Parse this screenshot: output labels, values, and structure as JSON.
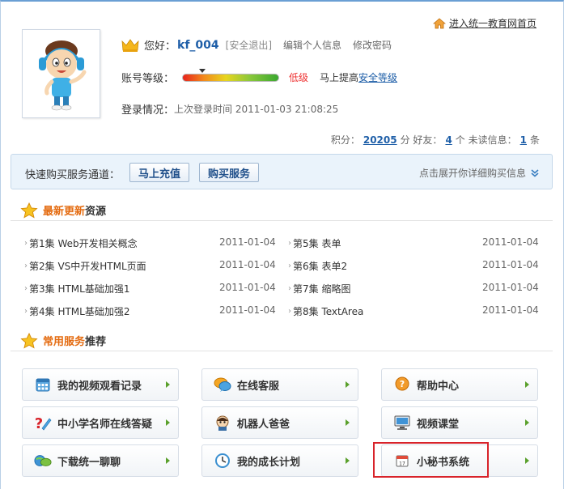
{
  "header": {
    "home_link": "进入统一教育网首页",
    "greeting": "您好：",
    "username": "kf_004",
    "logout": "[安全退出]",
    "edit_profile": "编辑个人信息",
    "change_password": "修改密码",
    "level_label": "账号等级：",
    "security_level": "低级",
    "improve_prefix": "马上提高",
    "improve_link": "安全等级",
    "security_level_fraction": 0.2,
    "login_label": "登录情况：",
    "last_login": "上次登录时间 2011-01-03 21:08:25"
  },
  "stats": {
    "points_label": "积分：",
    "points": "20205",
    "points_unit": "分 好友：",
    "friends": "4",
    "friends_unit": "个 未读信息：",
    "unread": "1",
    "unread_unit": "条"
  },
  "buybar": {
    "label": "快速购买服务通道：",
    "recharge": "马上充值",
    "buy_service": "购买服务",
    "expand": "点击展开你详细购买信息"
  },
  "latest": {
    "title_highlight": "最新更新",
    "title_rest": "资源",
    "items": [
      {
        "title": "第1集 Web开发相关概念",
        "date": "2011-01-04"
      },
      {
        "title": "第2集 VS中开发HTML页面",
        "date": "2011-01-04"
      },
      {
        "title": "第3集 HTML基础加强1",
        "date": "2011-01-04"
      },
      {
        "title": "第4集 HTML基础加强2",
        "date": "2011-01-04"
      },
      {
        "title": "第5集 表单",
        "date": "2011-01-04"
      },
      {
        "title": "第6集 表单2",
        "date": "2011-01-04"
      },
      {
        "title": "第7集 缩略图",
        "date": "2011-01-04"
      },
      {
        "title": "第8集 TextArea",
        "date": "2011-01-04"
      }
    ]
  },
  "services": {
    "title_highlight": "常用服务",
    "title_rest": "推荐",
    "items": [
      {
        "label": "我的视频观看记录",
        "icon": "calendar-grid-icon"
      },
      {
        "label": "在线客服",
        "icon": "chat-bubbles-icon"
      },
      {
        "label": "帮助中心",
        "icon": "help-bubble-icon"
      },
      {
        "label": "中小学名师在线答疑",
        "icon": "question-pen-icon"
      },
      {
        "label": "机器人爸爸",
        "icon": "robot-icon"
      },
      {
        "label": "视频课堂",
        "icon": "monitor-icon"
      },
      {
        "label": "下载统一聊聊",
        "icon": "chat-globe-icon"
      },
      {
        "label": "我的成长计划",
        "icon": "clock-icon"
      },
      {
        "label": "小秘书系统",
        "icon": "calendar-icon"
      }
    ]
  },
  "colors": {
    "accent_blue": "#1f5fa8",
    "accent_orange": "#e46b10",
    "highlight_red": "#d8232a",
    "arrow_green": "#5aa02c"
  }
}
